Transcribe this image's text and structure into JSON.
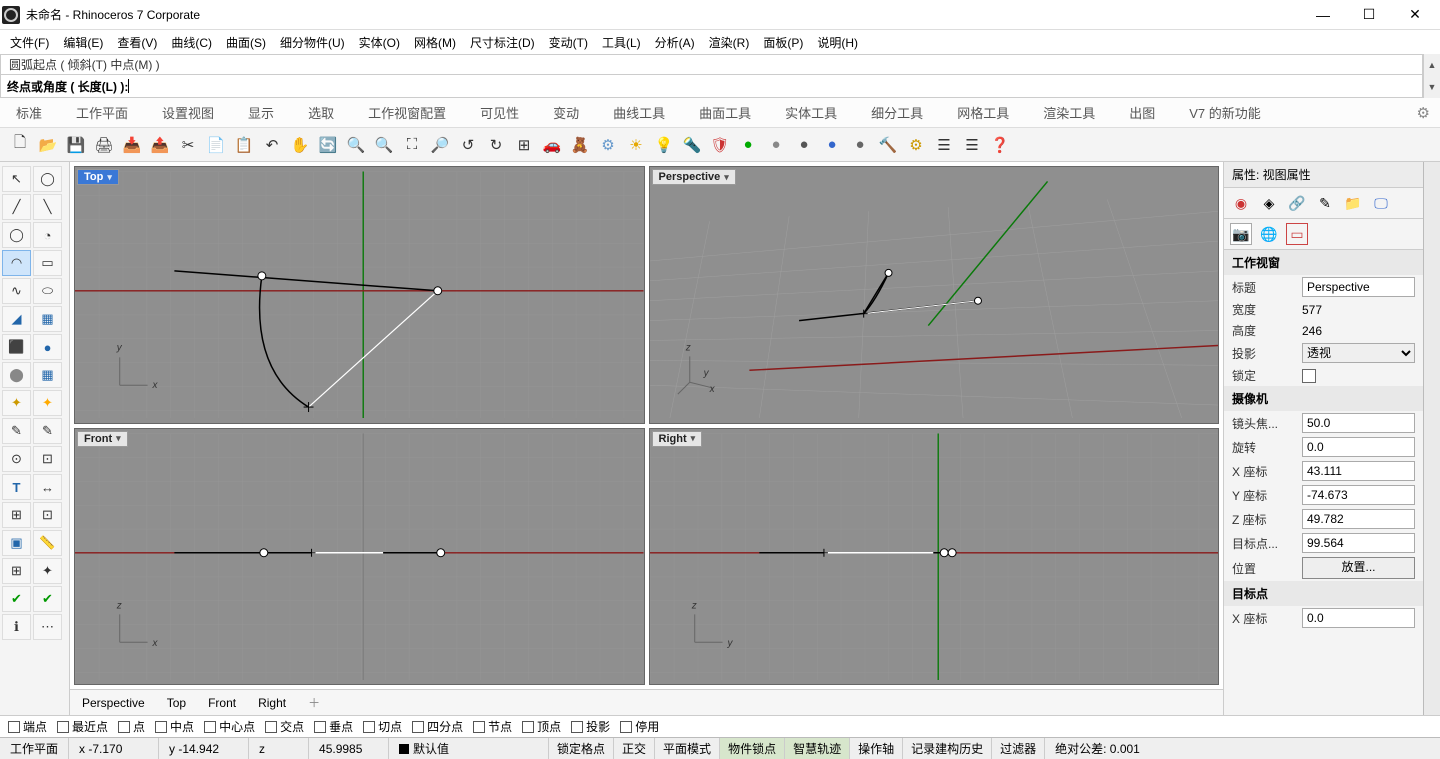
{
  "window": {
    "title": "未命名 - Rhinoceros 7 Corporate"
  },
  "menu": [
    "文件(F)",
    "编辑(E)",
    "查看(V)",
    "曲线(C)",
    "曲面(S)",
    "细分物件(U)",
    "实体(O)",
    "网格(M)",
    "尺寸标注(D)",
    "变动(T)",
    "工具(L)",
    "分析(A)",
    "渲染(R)",
    "面板(P)",
    "说明(H)"
  ],
  "command_history": "圆弧起点 ( 倾斜(T)  中点(M) )",
  "command_prompt": "终点或角度 ( 长度(L) ):",
  "tabs": [
    "标准",
    "工作平面",
    "设置视图",
    "显示",
    "选取",
    "工作视窗配置",
    "可见性",
    "变动",
    "曲线工具",
    "曲面工具",
    "实体工具",
    "细分工具",
    "网格工具",
    "渲染工具",
    "出图",
    "V7 的新功能"
  ],
  "viewports": {
    "topLeft": "Top",
    "topRight": "Perspective",
    "bottomLeft": "Front",
    "bottomRight": "Right"
  },
  "viewTabs": [
    "Perspective",
    "Top",
    "Front",
    "Right"
  ],
  "properties": {
    "header": "属性: 视图属性",
    "section1": "工作视窗",
    "title_lab": "标题",
    "title_val": "Perspective",
    "width_lab": "宽度",
    "width_val": "577",
    "height_lab": "高度",
    "height_val": "246",
    "proj_lab": "投影",
    "proj_val": "透视",
    "lock_lab": "锁定",
    "section2": "摄像机",
    "lens_lab": "镜头焦...",
    "lens_val": "50.0",
    "rot_lab": "旋转",
    "rot_val": "0.0",
    "x_lab": "X 座标",
    "x_val": "43.111",
    "y_lab": "Y 座标",
    "y_val": "-74.673",
    "z_lab": "Z 座标",
    "z_val": "49.782",
    "dist_lab": "目标点...",
    "dist_val": "99.564",
    "pos_lab": "位置",
    "pos_btn": "放置...",
    "section3": "目标点",
    "tx_lab": "X 座标",
    "tx_val": "0.0"
  },
  "osnaps": [
    "端点",
    "最近点",
    "点",
    "中点",
    "中心点",
    "交点",
    "垂点",
    "切点",
    "四分点",
    "节点",
    "顶点",
    "投影",
    "停用"
  ],
  "status": {
    "cplane": "工作平面",
    "x": "x -7.170",
    "y": "y -14.942",
    "z": "z",
    "extra": "45.9985",
    "layer": "默认值",
    "toggles": [
      "锁定格点",
      "正交",
      "平面模式",
      "物件锁点",
      "智慧轨迹",
      "操作轴",
      "记录建构历史",
      "过滤器"
    ],
    "toggles_on": [
      3,
      4
    ],
    "tol": "绝对公差: 0.001"
  }
}
